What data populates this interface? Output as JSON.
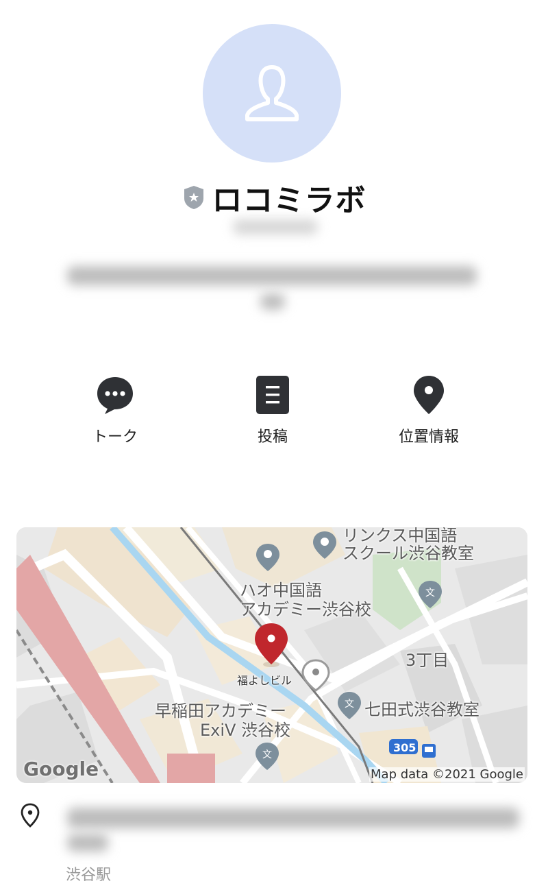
{
  "profile": {
    "name": "ロコミラボ",
    "avatar_icon": "person-silhouette-icon",
    "badge_icon": "verified-shield-icon",
    "accent_color": "#d5e0f8"
  },
  "actions": [
    {
      "label": "トーク",
      "icon": "chat-bubble-icon"
    },
    {
      "label": "投稿",
      "icon": "post-document-icon"
    },
    {
      "label": "位置情報",
      "icon": "location-pin-icon"
    }
  ],
  "map": {
    "labels": {
      "links1": "リンクス中国語",
      "links2": "スクール渋谷教室",
      "hao1": "ハオ中国語",
      "hao2": "アカデミー渋谷校",
      "building": "福よしビル",
      "chome": "3丁目",
      "waseda1": "早稲田アカデミー",
      "waseda2": "ExiV 渋谷校",
      "shichida": "七田式渋谷教室",
      "route": "305"
    },
    "logo": "Google",
    "credit": "Map data ©2021 Google",
    "marker_color": "#c0272d"
  },
  "address": {
    "station": "渋谷駅"
  }
}
